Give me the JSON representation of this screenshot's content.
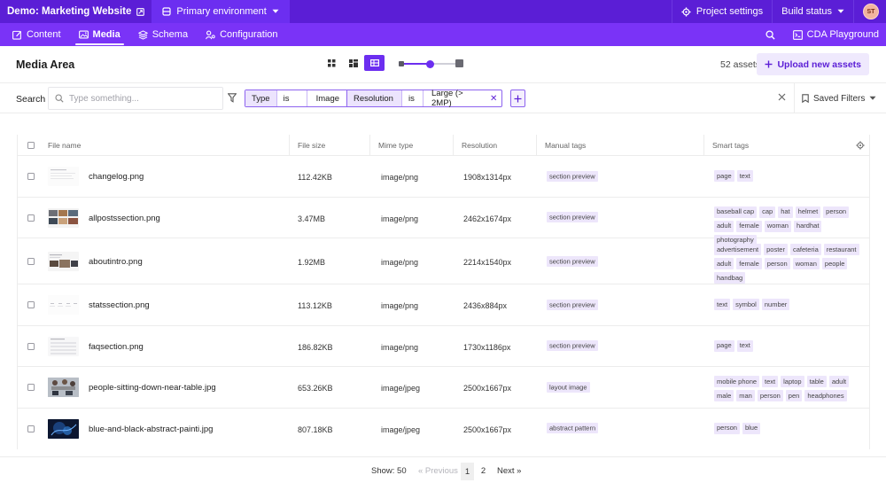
{
  "topbar": {
    "project_name": "Demo: Marketing Website",
    "environment": "Primary environment",
    "project_settings": "Project settings",
    "build_status": "Build status",
    "avatar_initials": "ST"
  },
  "nav": {
    "items": [
      {
        "label": "Content",
        "icon": "pencil-icon"
      },
      {
        "label": "Media",
        "icon": "image-icon"
      },
      {
        "label": "Schema",
        "icon": "layers-icon"
      },
      {
        "label": "Configuration",
        "icon": "config-icon"
      }
    ],
    "active": "Media",
    "cda_playground": "CDA Playground"
  },
  "header": {
    "title": "Media Area",
    "asset_count": "52 assets",
    "upload_label": "Upload new assets",
    "view_mode": "table",
    "zoom_level": 0.45
  },
  "search": {
    "label": "Search",
    "placeholder": "Type something..."
  },
  "filters": [
    {
      "field": "Type",
      "operator": "is",
      "value": "Image"
    },
    {
      "field": "Resolution",
      "operator": "is",
      "value": "Large (> 2MP)"
    }
  ],
  "saved_filters_label": "Saved Filters",
  "table": {
    "columns": [
      "File name",
      "File size",
      "Mime type",
      "Resolution",
      "Manual tags",
      "Smart tags"
    ],
    "rows": [
      {
        "name": "changelog.png",
        "size": "112.42KB",
        "mime": "image/png",
        "resolution": "1908x1314px",
        "manual_tag": "section preview",
        "smart_tags": [
          "page",
          "text"
        ]
      },
      {
        "name": "allpostssection.png",
        "size": "3.47MB",
        "mime": "image/png",
        "resolution": "2462x1674px",
        "manual_tag": "section preview",
        "smart_tags": [
          "baseball cap",
          "cap",
          "hat",
          "helmet",
          "person",
          "adult",
          "female",
          "woman",
          "hardhat",
          "photography"
        ]
      },
      {
        "name": "aboutintro.png",
        "size": "1.92MB",
        "mime": "image/png",
        "resolution": "2214x1540px",
        "manual_tag": "section preview",
        "smart_tags": [
          "advertisement",
          "poster",
          "cafeteria",
          "restaurant",
          "adult",
          "female",
          "person",
          "woman",
          "people",
          "handbag"
        ]
      },
      {
        "name": "statssection.png",
        "size": "113.12KB",
        "mime": "image/png",
        "resolution": "2436x884px",
        "manual_tag": "section preview",
        "smart_tags": [
          "text",
          "symbol",
          "number"
        ]
      },
      {
        "name": "faqsection.png",
        "size": "186.82KB",
        "mime": "image/png",
        "resolution": "1730x1186px",
        "manual_tag": "section preview",
        "smart_tags": [
          "page",
          "text"
        ]
      },
      {
        "name": "people-sitting-down-near-table.jpg",
        "size": "653.26KB",
        "mime": "image/jpeg",
        "resolution": "2500x1667px",
        "manual_tag": "layout image",
        "smart_tags": [
          "mobile phone",
          "text",
          "laptop",
          "table",
          "adult",
          "male",
          "man",
          "person",
          "pen",
          "headphones"
        ]
      },
      {
        "name": "blue-and-black-abstract-painti.jpg",
        "size": "807.18KB",
        "mime": "image/jpeg",
        "resolution": "2500x1667px",
        "manual_tag": "abstract pattern",
        "smart_tags": [
          "person",
          "blue"
        ]
      }
    ]
  },
  "pagination": {
    "show": "Show: 50",
    "prev": "« Previous",
    "pages": [
      "1",
      "2"
    ],
    "current": "1",
    "next": "Next »"
  },
  "colors": {
    "topbar": "#5b1ed6",
    "navbar": "#7a33f7",
    "accent": "#6c2ef0",
    "tag_bg": "#ede6fb"
  }
}
